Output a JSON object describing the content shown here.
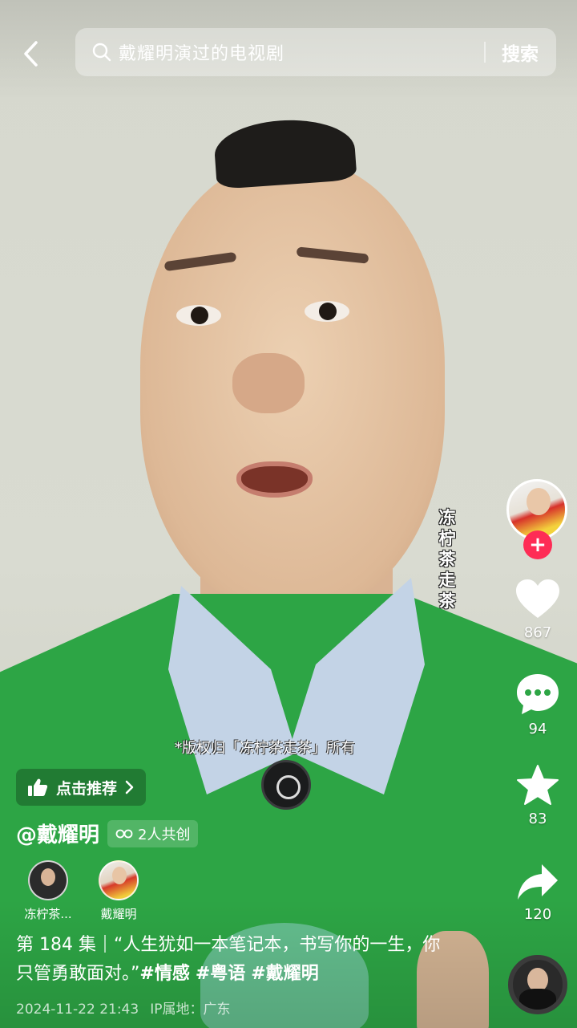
{
  "search": {
    "query": "戴耀明演过的电视剧",
    "button_label": "搜索"
  },
  "watermark": {
    "vertical": "冻柠茶走茶",
    "copyright": "*版权归「冻柠茶走茶」所有"
  },
  "actions": {
    "likes": "867",
    "comments": "94",
    "favorites": "83",
    "shares": "120",
    "follow_glyph": "+"
  },
  "recommend": {
    "label": "点击推荐"
  },
  "author": {
    "handle": "@戴耀明",
    "cocreate": "2人共创"
  },
  "creators": [
    {
      "name": "冻柠茶..."
    },
    {
      "name": "戴耀明"
    }
  ],
  "caption": {
    "episode": "第 184 集",
    "text": "“人生犹如一本笔记本，书写你的一生，你只管勇敢面对。”",
    "tags": [
      "#情感",
      "#粤语",
      "#戴耀明"
    ]
  },
  "meta": {
    "datetime": "2024-11-22 21:43",
    "location": "IP属地：广东"
  },
  "icons": {
    "back": "chevron-left-icon",
    "search": "search-icon",
    "like": "heart-icon",
    "comment": "comment-icon",
    "favorite": "star-icon",
    "share": "share-icon",
    "recommend": "thumbs-up-icon",
    "cocreate": "link-icon"
  },
  "colors": {
    "follow_red": "#fe2c55",
    "shirt_green": "#2da545"
  }
}
